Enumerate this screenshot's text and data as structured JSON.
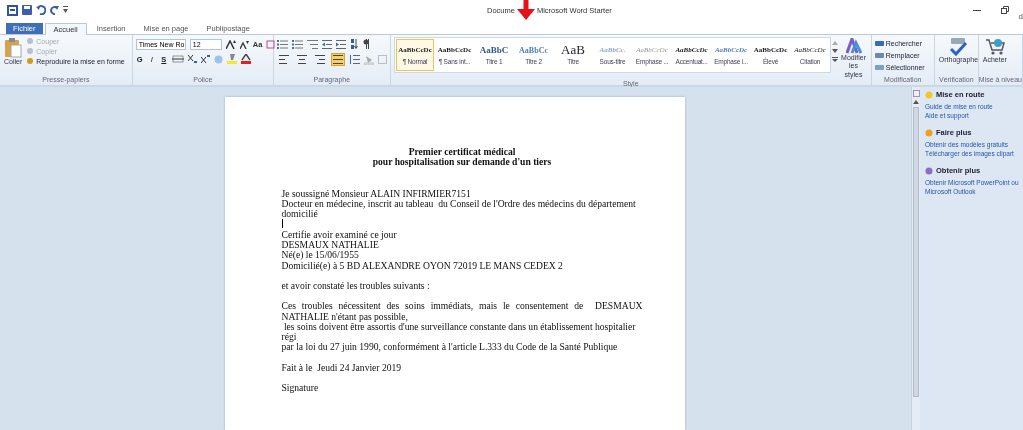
{
  "title_bar": {
    "title_start": "Docume",
    "title_end": "Microsoft Word Starter",
    "account": "d"
  },
  "tabs": [
    {
      "label": "Fichier",
      "kind": "file",
      "selected": false
    },
    {
      "label": "Accueil",
      "kind": "tab",
      "selected": true
    },
    {
      "label": "Insertion",
      "kind": "tab",
      "selected": false
    },
    {
      "label": "Mise en page",
      "kind": "tab",
      "selected": false
    },
    {
      "label": "Publipostage",
      "kind": "tab",
      "selected": false
    }
  ],
  "clipboard": {
    "label": "Presse-papiers",
    "paste": "Coller",
    "items": [
      {
        "label": "Couper",
        "disabled": true
      },
      {
        "label": "Copier",
        "disabled": true
      },
      {
        "label": "Reproduire la mise en forme",
        "disabled": false
      }
    ]
  },
  "font": {
    "label": "Police",
    "font_name": "Times New Ro",
    "font_size": "12",
    "change_case": "Aa",
    "format_buttons": [
      "G",
      "I",
      "S"
    ]
  },
  "paragraph": {
    "label": "Paragraphe",
    "alignments": [
      {
        "kind": "left",
        "selected": false
      },
      {
        "kind": "center",
        "selected": false
      },
      {
        "kind": "right",
        "selected": false
      },
      {
        "kind": "justify",
        "selected": true
      }
    ]
  },
  "styles": {
    "label": "Style",
    "items": [
      {
        "preview": "AaBbCcDc",
        "label": "¶ Normal",
        "kind": "normal",
        "selected": true
      },
      {
        "preview": "AaBbCcDc",
        "label": "¶ Sans int...",
        "kind": "normal",
        "selected": false
      },
      {
        "preview": "AaBbC",
        "label": "Titre 1",
        "kind": "h1",
        "selected": false
      },
      {
        "preview": "AaBbCc",
        "label": "Titre 2",
        "kind": "h2",
        "selected": false
      },
      {
        "preview": "AaB",
        "label": "Titre",
        "kind": "title",
        "selected": false
      },
      {
        "preview": "AaBbCc.",
        "label": "Sous-titre",
        "kind": "subtitle",
        "selected": false
      },
      {
        "preview": "AaBbCcDc",
        "label": "Emphase ...",
        "kind": "subtle",
        "selected": false
      },
      {
        "preview": "AaBbCcDc",
        "label": "Accentuat...",
        "kind": "emphasis",
        "selected": false
      },
      {
        "preview": "AaBbCcDc",
        "label": "Emphase i...",
        "kind": "intense",
        "selected": false
      },
      {
        "preview": "AaBbCcDc",
        "label": "Élevé",
        "kind": "strong",
        "selected": false
      },
      {
        "preview": "AaBbCcDc",
        "label": "Citation",
        "kind": "quote",
        "selected": false
      }
    ],
    "change_styles": "Modifier les styles"
  },
  "editing": {
    "label": "Modification",
    "items": [
      "Rechercher",
      "Remplacer",
      "Sélectionner"
    ]
  },
  "proofing": {
    "label": "Vérification",
    "button": "Orthographe"
  },
  "upgrade": {
    "label": "Mise à niveau",
    "button": "Acheter"
  },
  "document": {
    "blocks": [
      {
        "kind": "title",
        "lines": [
          {
            "text": "Premier certificat médical"
          },
          {
            "text": "pour hospitalisation sur demande d'un tiers"
          }
        ]
      },
      {
        "kind": "body",
        "lines": [
          {
            "text": "Je soussigné Monsieur ALAIN INFIRMIER7151"
          },
          {
            "text": "Docteur en médecine, inscrit au tableau  du Conseil de l'Ordre des médecins du département"
          },
          {
            "text": "domicilié"
          }
        ]
      },
      {
        "kind": "caret"
      },
      {
        "kind": "body",
        "lines": [
          {
            "text": "Certifie avoir examiné ce jour"
          },
          {
            "text": "DESMAUX NATHALIE"
          },
          {
            "text": "Né(e) le 15/06/1955"
          },
          {
            "text": "Domicilié(e) à 5 BD ALEXANDRE OYON 72019 LE MANS CEDEX 2"
          }
        ]
      },
      {
        "kind": "body",
        "lines": [
          {
            "text": "et avoir constaté les troubles suivants :"
          }
        ]
      },
      {
        "kind": "body",
        "lines": [
          {
            "text": "Ces troubles nécessitent des soins immédiats, mais le consentement de  DESMAUX",
            "justify": true
          },
          {
            "text": "NATHALIE n'étant pas possible,"
          },
          {
            "text": " les soins doivent être assortis d'une surveillance constante dans un établissement hospitalier"
          },
          {
            "text": "régi"
          },
          {
            "text": "par la loi du 27 juin 1990, conformément à l'article L.333 du Code de la Santé Publique"
          }
        ]
      },
      {
        "kind": "body",
        "lines": [
          {
            "text": "Fait à le  Jeudi 24 Janvier 2019"
          }
        ]
      },
      {
        "kind": "body",
        "lines": [
          {
            "text": "Signature"
          }
        ]
      }
    ]
  },
  "task_pane": {
    "sections": [
      {
        "heading": "Mise en route",
        "kind": "start",
        "links": [
          "Guide de mise en route",
          "Aide et support"
        ]
      },
      {
        "heading": "Faire plus",
        "kind": "more",
        "links": [
          "Obtenir des modèles gratuits",
          "Télécharger des images clipart"
        ]
      },
      {
        "heading": "Obtenir plus",
        "kind": "get",
        "links": [
          "Obtenir Microsoft PowerPoint ou Microsoft Outlook"
        ]
      }
    ]
  }
}
